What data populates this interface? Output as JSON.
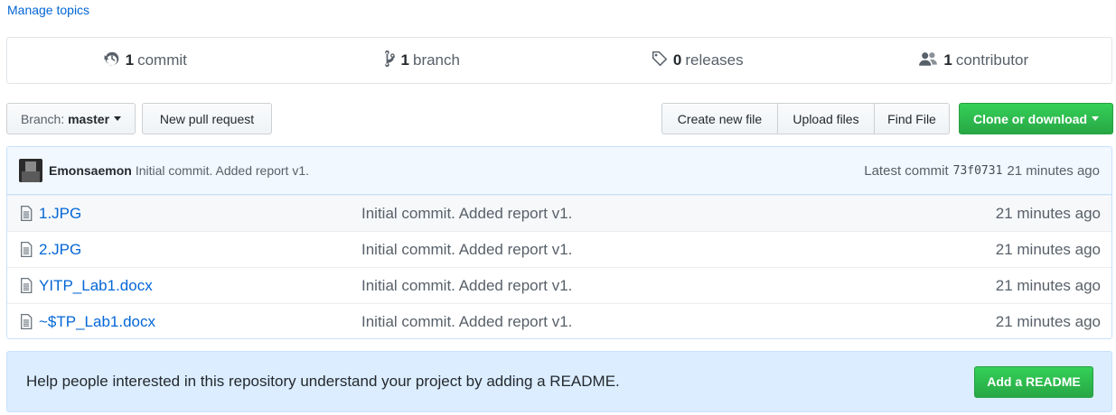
{
  "topics": {
    "manage_label": "Manage topics"
  },
  "numbers": {
    "commits": {
      "count": "1",
      "label": "commit",
      "icon": "history-icon"
    },
    "branches": {
      "count": "1",
      "label": "branch",
      "icon": "git-branch-icon"
    },
    "releases": {
      "count": "0",
      "label": "releases",
      "icon": "tag-icon"
    },
    "contributors": {
      "count": "1",
      "label": "contributor",
      "icon": "people-icon"
    }
  },
  "toolbar": {
    "branch_prefix": "Branch:",
    "branch_name": "master",
    "new_pull_request": "New pull request",
    "create_new_file": "Create new file",
    "upload_files": "Upload files",
    "find_file": "Find File",
    "clone_or_download": "Clone or download"
  },
  "latest_commit": {
    "author": "Emonsaemon",
    "message": "Initial commit. Added report v1.",
    "label": "Latest commit",
    "sha": "73f0731",
    "age": "21 minutes ago"
  },
  "files": [
    {
      "name": "1.JPG",
      "message": "Initial commit. Added report v1.",
      "age": "21 minutes ago"
    },
    {
      "name": "2.JPG",
      "message": "Initial commit. Added report v1.",
      "age": "21 minutes ago"
    },
    {
      "name": "YITP_Lab1.docx",
      "message": "Initial commit. Added report v1.",
      "age": "21 minutes ago"
    },
    {
      "name": "~$TP_Lab1.docx",
      "message": "Initial commit. Added report v1.",
      "age": "21 minutes ago"
    }
  ],
  "readme_prompt": {
    "text": "Help people interested in this repository understand your project by adding a README.",
    "button": "Add a README"
  },
  "colors": {
    "link": "#0366d6",
    "green": "#28a745",
    "readme_bg": "#dbedff",
    "commit_bg": "#f1f8ff"
  }
}
